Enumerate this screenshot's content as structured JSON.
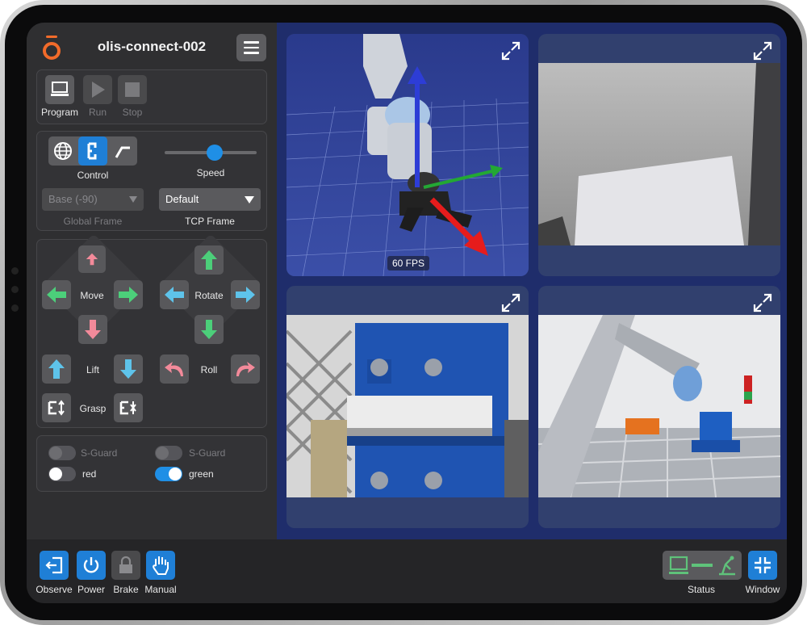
{
  "app": {
    "title": "olis-connect-002"
  },
  "program": {
    "program": "Program",
    "run": "Run",
    "stop": "Stop"
  },
  "control": {
    "label": "Control",
    "speed_label": "Speed",
    "speed_value": 0.55,
    "global_frame_value": "Base (-90)",
    "global_frame_label": "Global Frame",
    "tcp_frame_value": "Default",
    "tcp_frame_label": "TCP Frame"
  },
  "jog": {
    "move": "Move",
    "rotate": "Rotate",
    "lift": "Lift",
    "roll": "Roll",
    "grasp": "Grasp"
  },
  "guards": {
    "sguard1": "S-Guard",
    "sguard2": "S-Guard",
    "red": "red",
    "green": "green",
    "green_on": true,
    "red_on": false
  },
  "views": {
    "fps": "60 FPS"
  },
  "bottom": {
    "observe": "Observe",
    "power": "Power",
    "brake": "Brake",
    "manual": "Manual",
    "status": "Status",
    "window": "Window"
  },
  "colors": {
    "accent": "#1f7fd6",
    "logo": "#f26b2a",
    "up_pink": "#f38a9a",
    "green": "#4ccf7a",
    "cyan": "#5ec3ea"
  }
}
